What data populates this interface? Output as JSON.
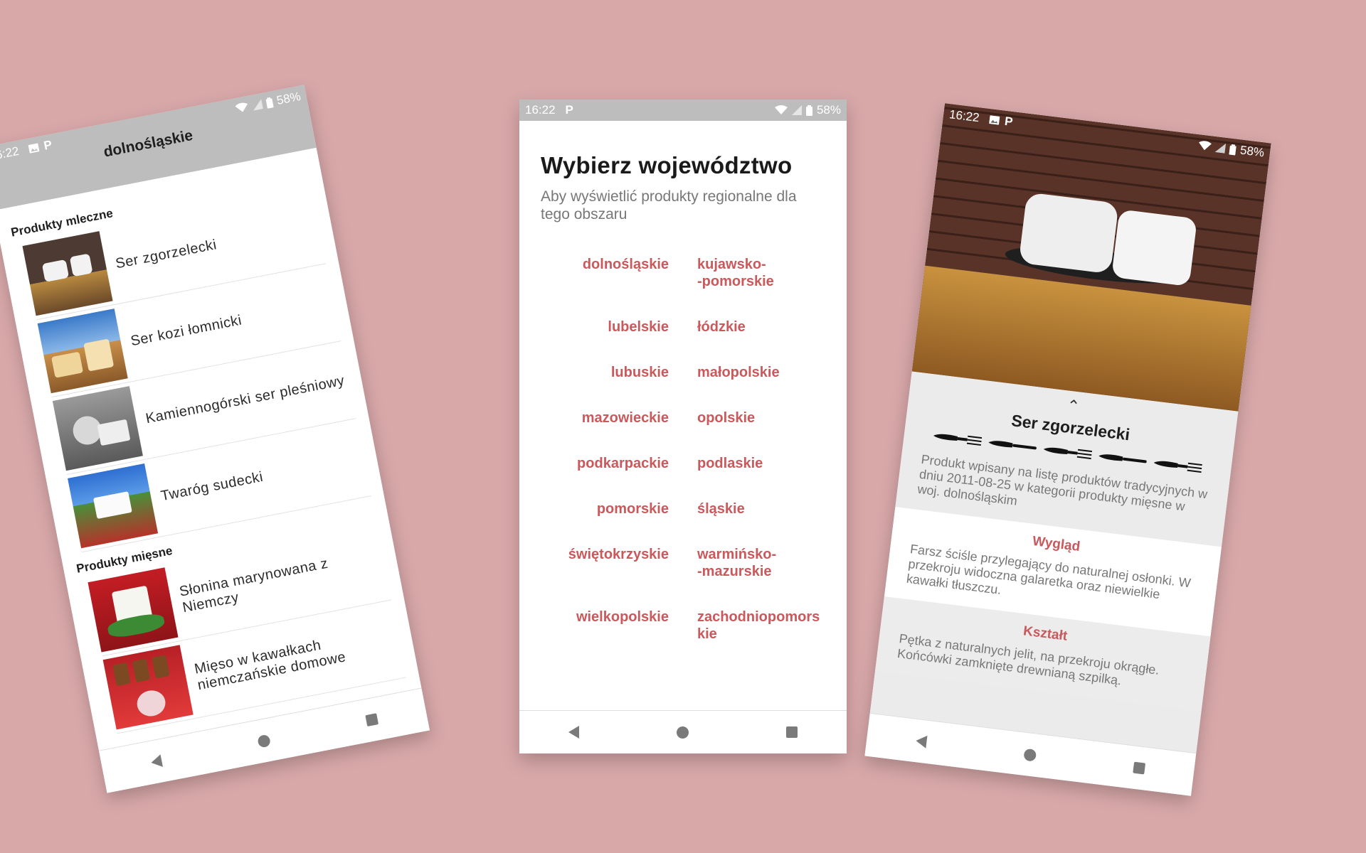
{
  "status": {
    "time": "16:22",
    "battery": "58%"
  },
  "left_screen": {
    "title": "dolnośląskie",
    "categories": [
      {
        "name": "Produkty mleczne",
        "items": [
          "Ser zgorzelecki",
          "Ser kozi łomnicki",
          "Kamiennogórski ser pleśniowy",
          "Twaróg sudecki"
        ]
      },
      {
        "name": "Produkty mięsne",
        "items": [
          "Słonina marynowana z Niemczy",
          "Mięso w kawałkach niemczańskie domowe"
        ]
      }
    ]
  },
  "middle_screen": {
    "title": "Wybierz województwo",
    "subtitle": "Aby wyświetlić produkty regionalne dla tego obszaru",
    "regions": [
      [
        "dolnośląskie",
        "kujawsko-\n-pomorskie"
      ],
      [
        "lubelskie",
        "łódzkie"
      ],
      [
        "lubuskie",
        "małopolskie"
      ],
      [
        "mazowieckie",
        "opolskie"
      ],
      [
        "podkarpackie",
        "podlaskie"
      ],
      [
        "pomorskie",
        "śląskie"
      ],
      [
        "świętokrzyskie",
        "warmińsko-\n-mazurskie"
      ],
      [
        "wielkopolskie",
        "zachodniopomors\nkie"
      ]
    ]
  },
  "right_screen": {
    "product_title": "Ser zgorzelecki",
    "rating": 5,
    "description": "Produkt wpisany na listę produktów tradycyjnych w dniu 2011-08-25 w kategorii produkty mięsne w woj. dolnośląskim",
    "sections": [
      {
        "title": "Wygląd",
        "text": "Farsz ściśle przylegający do naturalnej osłonki. W przekroju widoczna galaretka oraz niewielkie kawałki tłuszczu."
      },
      {
        "title": "Kształt",
        "text": "Pętka z naturalnych jelit, na przekroju okrągłe. Końcówki zamknięte drewnianą szpilką."
      }
    ]
  },
  "icons": {
    "image_notification": "image-icon",
    "parking_notification": "p-icon",
    "wifi": "wifi-icon",
    "signal": "signal-icon",
    "battery": "battery-icon",
    "rating_mark": "knife-fork-icon"
  },
  "colors": {
    "background": "#d8a8a9",
    "accent": "#c9595c",
    "bars": "#bdbdbd"
  }
}
